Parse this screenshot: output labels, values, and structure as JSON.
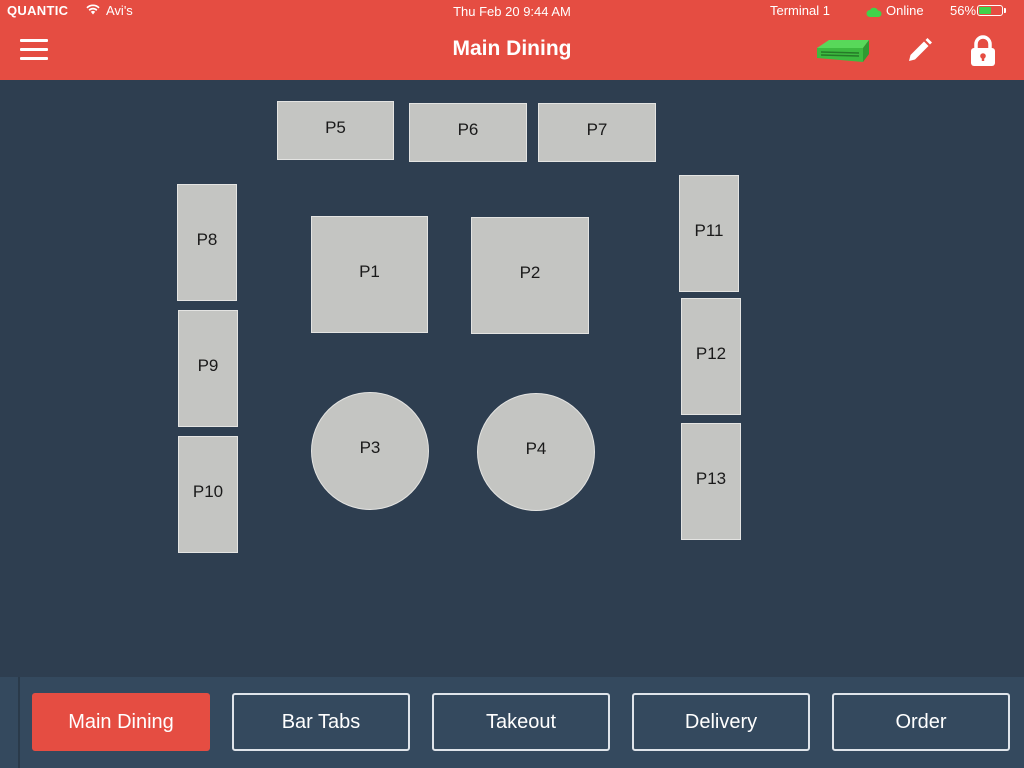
{
  "status_bar": {
    "carrier": "QUANTIC",
    "network": "Avi's",
    "time": "Thu Feb 20  9:44 AM",
    "terminal": "Terminal 1",
    "connection": "Online",
    "battery": "56%",
    "battery_level": 0.56
  },
  "header": {
    "title": "Main Dining",
    "icons": [
      "menu-icon",
      "printer-icon",
      "pencil-icon",
      "lock-icon"
    ],
    "accent_color": "#e54d42"
  },
  "floor": {
    "background_color": "#2e3e50",
    "tables": [
      {
        "id": "p5",
        "label": "P5",
        "shape": "rectangle"
      },
      {
        "id": "p6",
        "label": "P6",
        "shape": "rectangle"
      },
      {
        "id": "p7",
        "label": "P7",
        "shape": "rectangle"
      },
      {
        "id": "p8",
        "label": "P8",
        "shape": "rectangle"
      },
      {
        "id": "p1",
        "label": "P1",
        "shape": "square"
      },
      {
        "id": "p2",
        "label": "P2",
        "shape": "square"
      },
      {
        "id": "p11",
        "label": "P11",
        "shape": "rectangle"
      },
      {
        "id": "p9",
        "label": "P9",
        "shape": "rectangle"
      },
      {
        "id": "p12",
        "label": "P12",
        "shape": "rectangle"
      },
      {
        "id": "p3",
        "label": "P3",
        "shape": "round"
      },
      {
        "id": "p4",
        "label": "P4",
        "shape": "round"
      },
      {
        "id": "p10",
        "label": "P10",
        "shape": "rectangle"
      },
      {
        "id": "p13",
        "label": "P13",
        "shape": "rectangle"
      }
    ]
  },
  "bottom_tabs": [
    {
      "label": "Main Dining",
      "active": true
    },
    {
      "label": "Bar Tabs",
      "active": false
    },
    {
      "label": "Takeout",
      "active": false
    },
    {
      "label": "Delivery",
      "active": false
    },
    {
      "label": "Order",
      "active": false
    }
  ]
}
